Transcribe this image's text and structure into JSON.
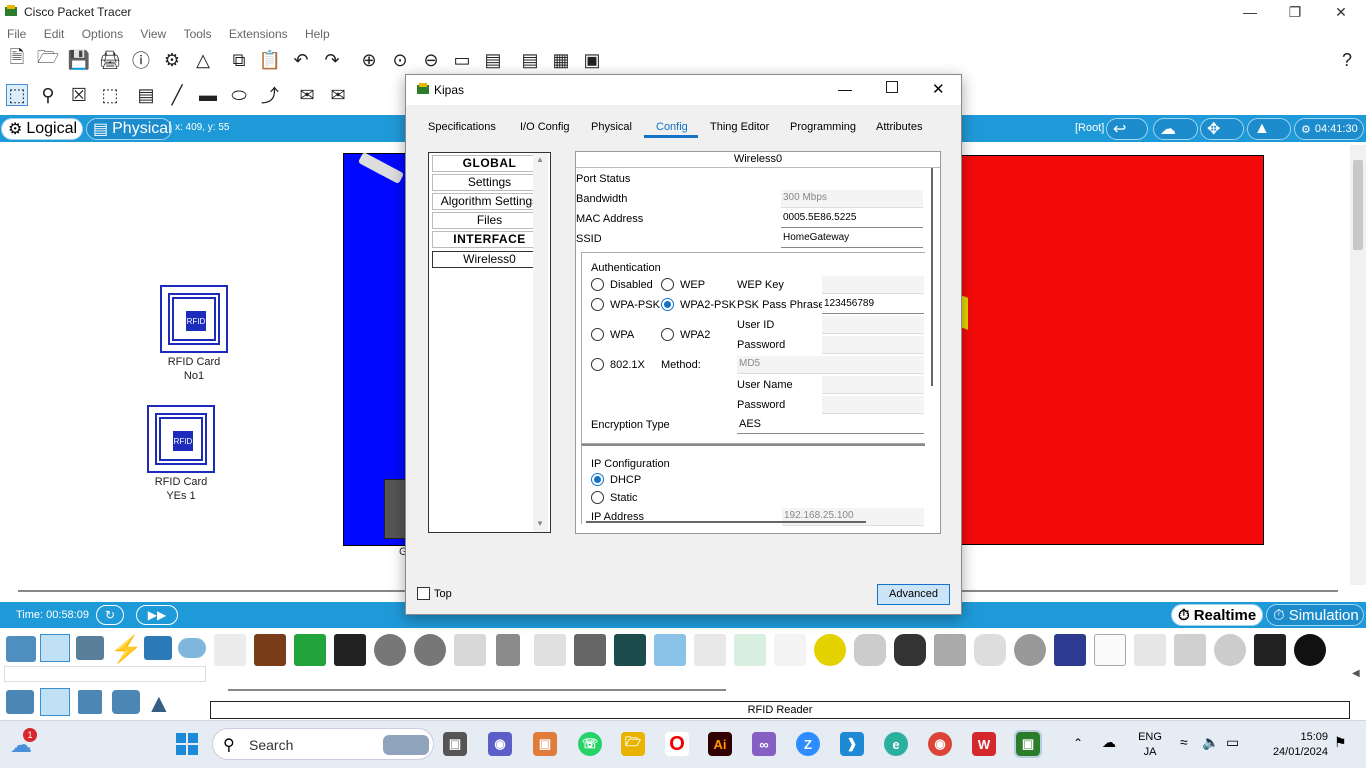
{
  "app": {
    "title": "Cisco Packet Tracer",
    "menu": [
      "File",
      "Edit",
      "Options",
      "View",
      "Tools",
      "Extensions",
      "Help"
    ],
    "help_icon": "?"
  },
  "modebar": {
    "logical_label": "Logical",
    "physical_label": "Physical",
    "coords": "x: 409, y: 55",
    "root_label": "[Root]",
    "clock": "04:41:30"
  },
  "workspace": {
    "rfid_glyph": "RFID",
    "devices": [
      {
        "label_line1": "RFID Card",
        "label_line2": "No1"
      },
      {
        "label_line1": "RFID Card",
        "label_line2": "YEs 1"
      }
    ],
    "partial_label": "G"
  },
  "statusbar": {
    "time": "Time: 00:58:09",
    "realtime_label": "Realtime",
    "simulation_label": "Simulation"
  },
  "device_info": "RFID Reader",
  "dialog": {
    "title": "Kipas",
    "tabs": [
      "Specifications",
      "I/O Config",
      "Physical",
      "Config",
      "Thing Editor",
      "Programming",
      "Attributes"
    ],
    "active_tab": "Config",
    "nav": {
      "global_header": "GLOBAL",
      "settings": "Settings",
      "algorithm_settings": "Algorithm Settings",
      "files": "Files",
      "interface_header": "INTERFACE",
      "wireless0": "Wireless0"
    },
    "panel": {
      "heading": "Wireless0",
      "port_status_label": "Port Status",
      "bandwidth_label": "Bandwidth",
      "bandwidth_value": "300 Mbps",
      "mac_label": "MAC Address",
      "mac_value": "0005.5E86.5225",
      "ssid_label": "SSID",
      "ssid_value": "HomeGateway",
      "auth": {
        "title": "Authentication",
        "disabled": "Disabled",
        "wep": "WEP",
        "wep_key_label": "WEP Key",
        "wpa_psk": "WPA-PSK",
        "wpa2_psk": "WPA2-PSK",
        "psk_label": "PSK Pass Phrase",
        "psk_value": "123456789",
        "wpa": "WPA",
        "wpa2": "WPA2",
        "user_id_label": "User ID",
        "password_label": "Password",
        "dot1x": "802.1X",
        "method_label": "Method:",
        "method_value": "MD5",
        "user_name_label": "User Name",
        "password2_label": "Password",
        "selected": "WPA2-PSK"
      },
      "encryption_label": "Encryption Type",
      "encryption_value": "AES",
      "ip": {
        "title": "IP Configuration",
        "dhcp": "DHCP",
        "static": "Static",
        "selected": "DHCP",
        "ip_label": "IP Address",
        "ip_value": "192.168.25.100"
      }
    },
    "top_label": "Top",
    "top_checked": false,
    "advanced_label": "Advanced",
    "window_controls": [
      "minimize",
      "maximize",
      "close"
    ]
  },
  "taskbar": {
    "notification_count": "1",
    "search_label": "Search",
    "lang_line1": "ENG",
    "lang_line2": "JA",
    "time": "15:09",
    "date": "24/01/2024"
  },
  "colors": {
    "accent_blue": "#1f9ad9",
    "selection_blue": "#1273c9",
    "blue_panel": "#0008ff",
    "red_panel": "#f50a0a"
  }
}
